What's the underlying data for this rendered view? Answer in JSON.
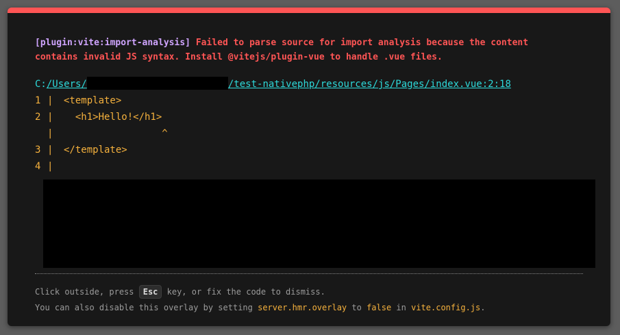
{
  "error": {
    "plugin": "[plugin:vite:import-analysis]",
    "message": "Failed to parse source for import analysis because the content contains invalid JS syntax. Install @vitejs/plugin-vue to handle .vue files."
  },
  "file": {
    "prefix": "C:",
    "users_segment": "/Users/",
    "path_rest": "/test-nativephp/resources/js/Pages/index.vue:2:18"
  },
  "frame": {
    "lines": [
      {
        "num": "1",
        "bar": "|",
        "code": "<template>"
      },
      {
        "num": "2",
        "bar": "|",
        "code": "  <h1>Hello!</h1>"
      },
      {
        "num": "",
        "bar": "|",
        "code": "                 ^"
      },
      {
        "num": "3",
        "bar": "|",
        "code": "</template>"
      },
      {
        "num": "4",
        "bar": "|",
        "code": ""
      }
    ]
  },
  "tip": {
    "line1_before": "Click outside, press ",
    "key": "Esc",
    "line1_after": " key, or fix the code to dismiss.",
    "line2_before": "You can also disable this overlay by setting ",
    "config_key": "server.hmr.overlay",
    "line2_mid": " to ",
    "config_value": "false",
    "line2_in": " in ",
    "config_file": "vite.config.js",
    "line2_end": "."
  },
  "colors": {
    "accent_red": "#ff5555",
    "plugin_purple": "#cfa4ff",
    "file_cyan": "#2dd9da",
    "code_yellow": "#f5b13d"
  }
}
